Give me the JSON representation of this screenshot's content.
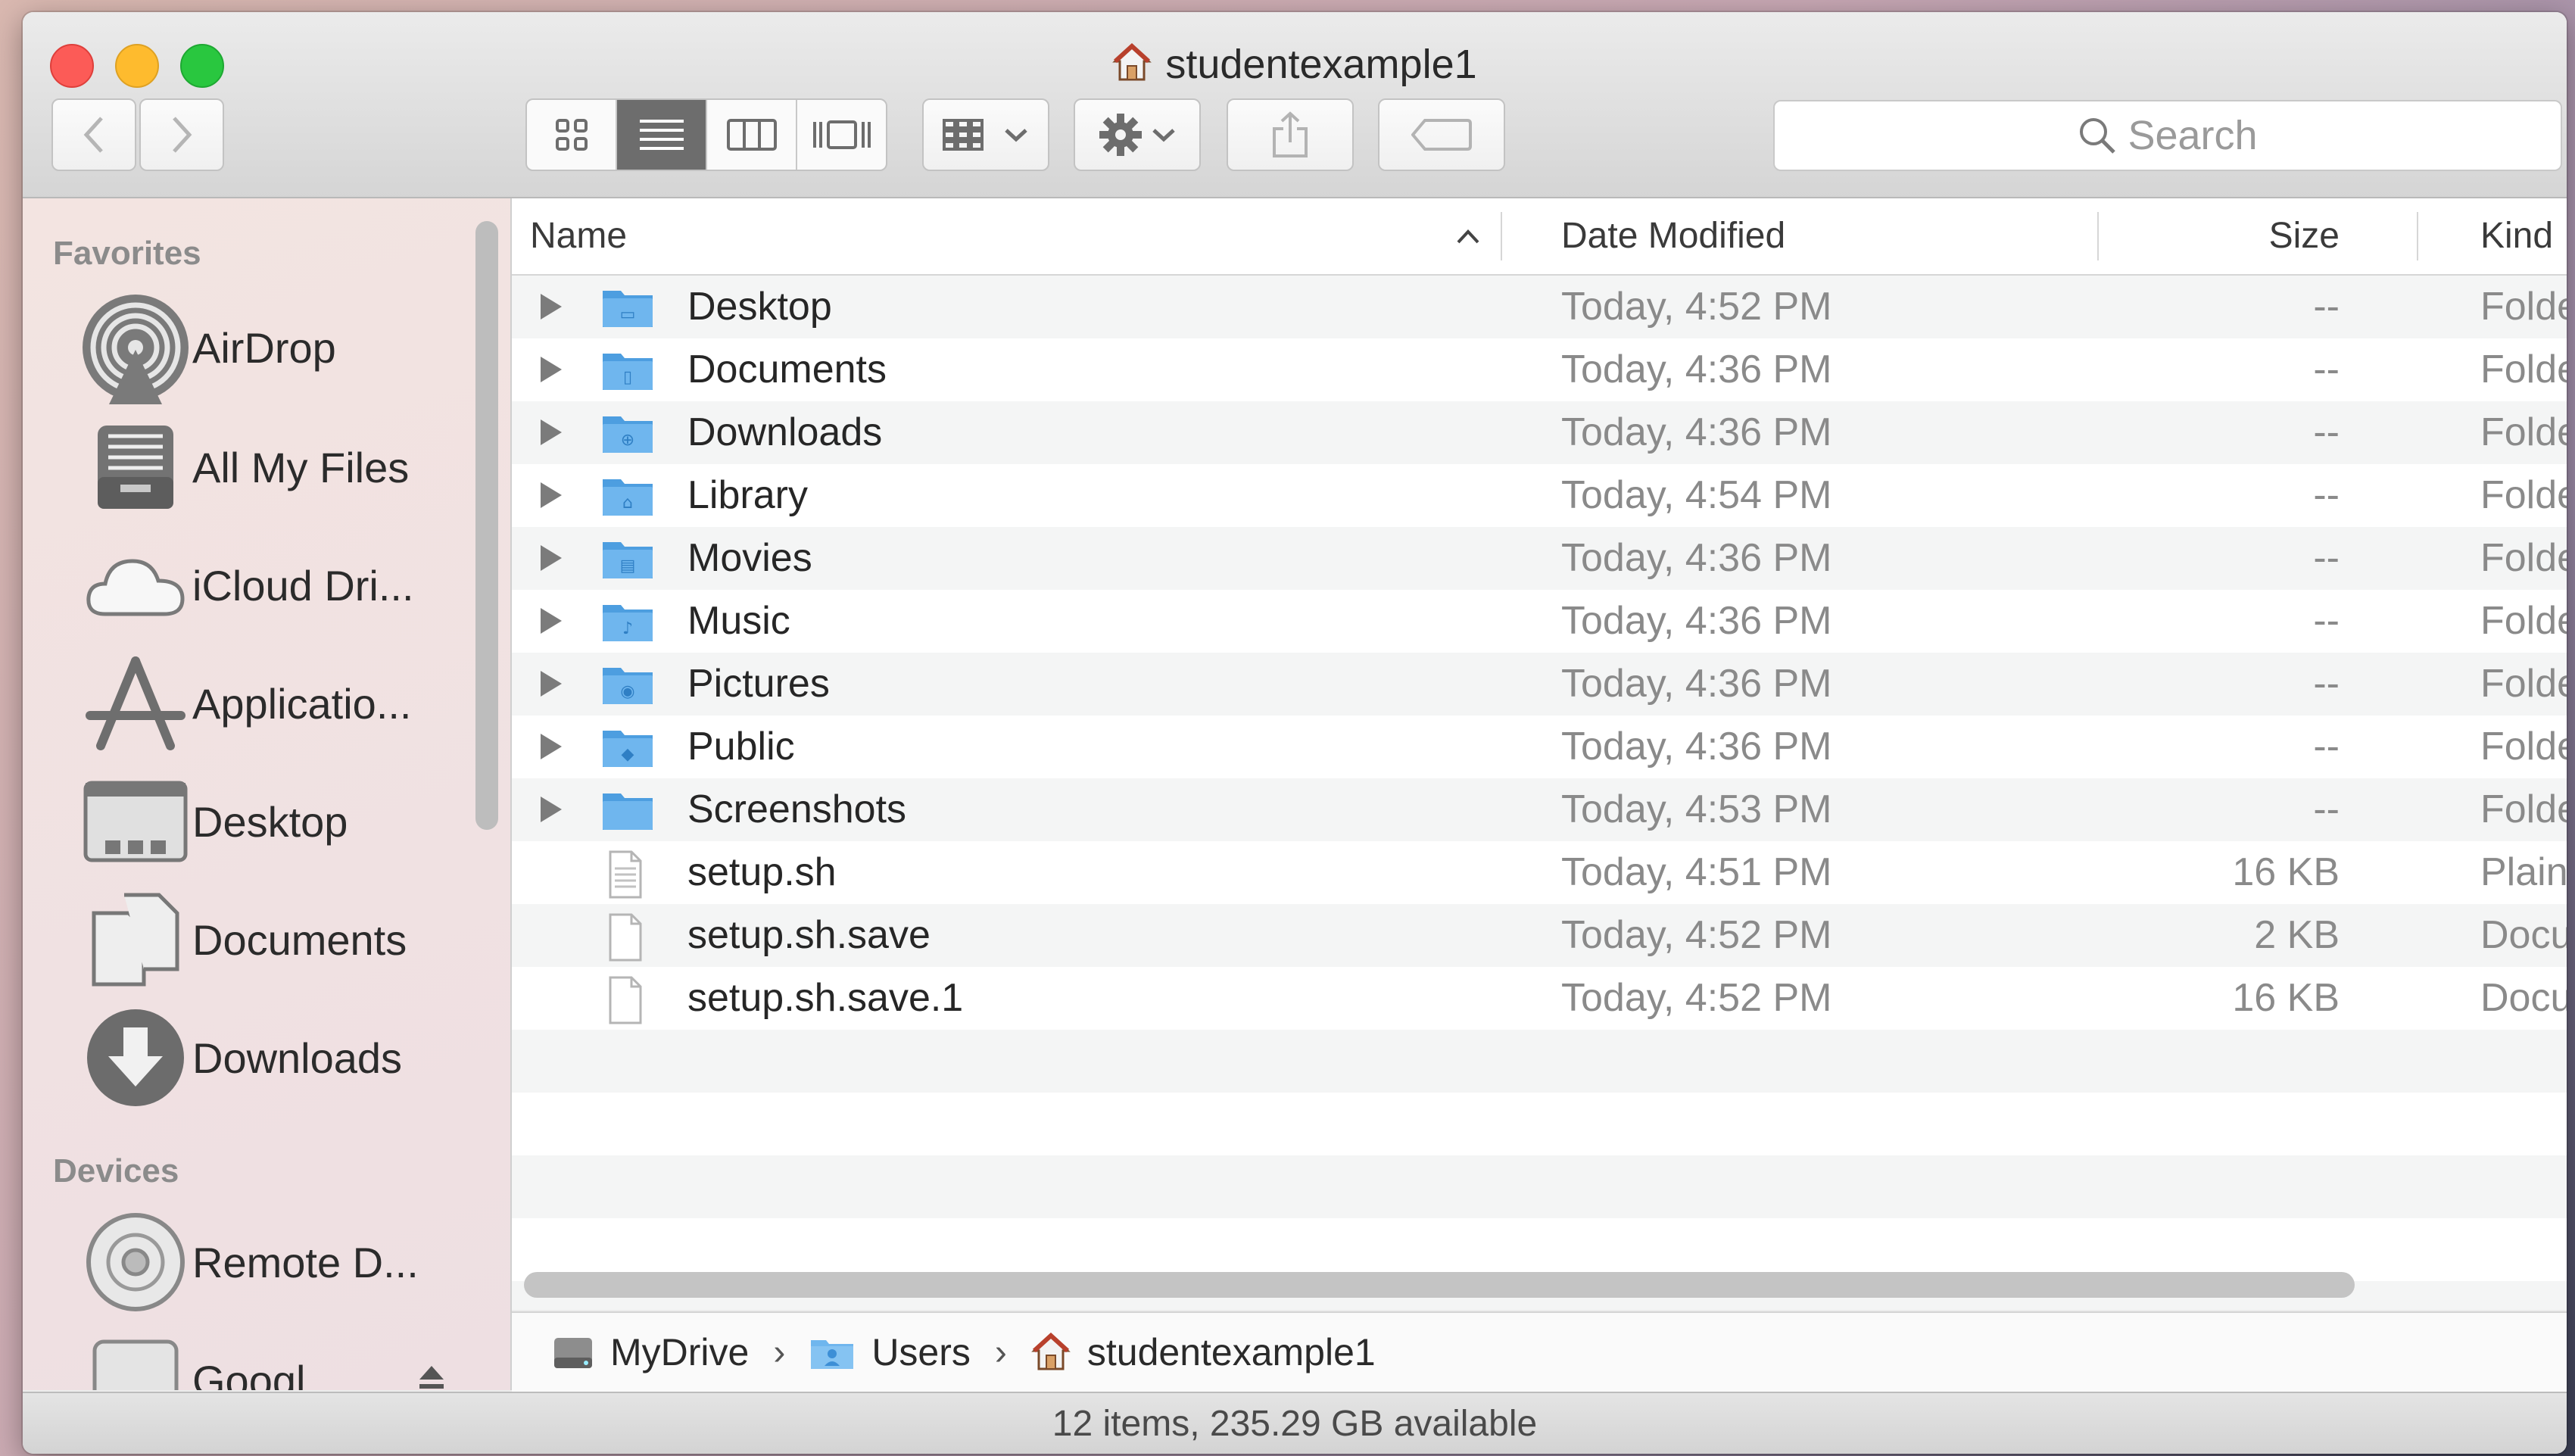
{
  "window": {
    "title": "studentexample1",
    "status": "12 items, 235.29 GB available"
  },
  "toolbar": {
    "search_placeholder": "Search",
    "view_modes": [
      "icon",
      "list",
      "column",
      "cover-flow"
    ],
    "active_view": "list"
  },
  "sidebar": {
    "favorites_header": "Favorites",
    "favorites": [
      {
        "label": "AirDrop",
        "icon": "airdrop-icon"
      },
      {
        "label": "All My Files",
        "icon": "all-my-files-icon"
      },
      {
        "label": "iCloud Dri...",
        "icon": "icloud-icon"
      },
      {
        "label": "Applicatio...",
        "icon": "applications-icon"
      },
      {
        "label": "Desktop",
        "icon": "desktop-icon"
      },
      {
        "label": "Documents",
        "icon": "documents-icon"
      },
      {
        "label": "Downloads",
        "icon": "downloads-icon"
      }
    ],
    "devices_header": "Devices",
    "devices": [
      {
        "label": "Remote D...",
        "icon": "remote-disc-icon"
      },
      {
        "label": "Googl",
        "icon": "drive-icon"
      }
    ]
  },
  "list": {
    "columns": {
      "name": "Name",
      "date": "Date Modified",
      "size": "Size",
      "kind": "Kind"
    },
    "rows": [
      {
        "name": "Desktop",
        "date": "Today, 4:52 PM",
        "size": "--",
        "kind": "Folder",
        "type": "folder",
        "glyph": "▭"
      },
      {
        "name": "Documents",
        "date": "Today, 4:36 PM",
        "size": "--",
        "kind": "Folder",
        "type": "folder",
        "glyph": "▯"
      },
      {
        "name": "Downloads",
        "date": "Today, 4:36 PM",
        "size": "--",
        "kind": "Folder",
        "type": "folder",
        "glyph": "⊕"
      },
      {
        "name": "Library",
        "date": "Today, 4:54 PM",
        "size": "--",
        "kind": "Folder",
        "type": "folder",
        "glyph": "⌂"
      },
      {
        "name": "Movies",
        "date": "Today, 4:36 PM",
        "size": "--",
        "kind": "Folder",
        "type": "folder",
        "glyph": "▤"
      },
      {
        "name": "Music",
        "date": "Today, 4:36 PM",
        "size": "--",
        "kind": "Folder",
        "type": "folder",
        "glyph": "♪"
      },
      {
        "name": "Pictures",
        "date": "Today, 4:36 PM",
        "size": "--",
        "kind": "Folder",
        "type": "folder",
        "glyph": "◉"
      },
      {
        "name": "Public",
        "date": "Today, 4:36 PM",
        "size": "--",
        "kind": "Folder",
        "type": "folder",
        "glyph": "◆"
      },
      {
        "name": "Screenshots",
        "date": "Today, 4:53 PM",
        "size": "--",
        "kind": "Folder",
        "type": "folder",
        "glyph": ""
      },
      {
        "name": "setup.sh",
        "date": "Today, 4:51 PM",
        "size": "16 KB",
        "kind": "Plain Text",
        "type": "text"
      },
      {
        "name": "setup.sh.save",
        "date": "Today, 4:52 PM",
        "size": "2 KB",
        "kind": "Document",
        "type": "doc"
      },
      {
        "name": "setup.sh.save.1",
        "date": "Today, 4:52 PM",
        "size": "16 KB",
        "kind": "Document",
        "type": "doc"
      }
    ]
  },
  "pathbar": [
    "MyDrive",
    "Users",
    "studentexample1"
  ],
  "colors": {
    "folder": "#6fb6ee",
    "folder_dark": "#4d9ee0",
    "active_view": "#6d6d6d"
  }
}
